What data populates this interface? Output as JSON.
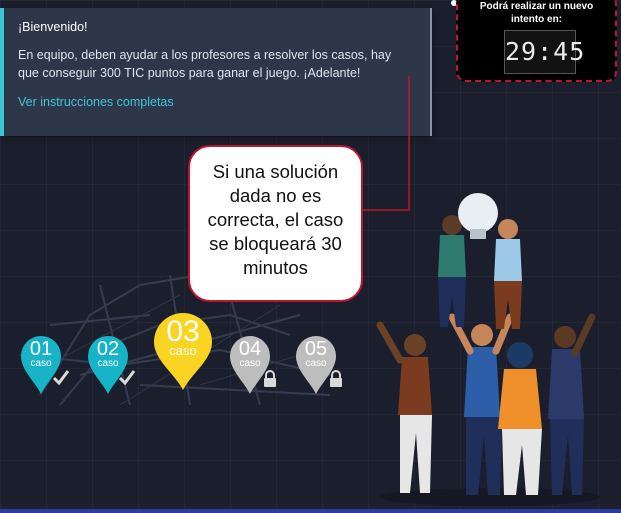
{
  "welcome": {
    "title": "¡Bienvenido!",
    "line1": "En equipo, deben ayudar a los profesores a resolver los casos, hay",
    "line2": "que conseguir 300 TIC puntos para ganar el juego. ¡Adelante!",
    "link": "Ver instrucciones completas"
  },
  "timer": {
    "label_line1": "Podrá realizar un nuevo",
    "label_line2": "intento en:",
    "value": "29:45"
  },
  "callout": {
    "lines": [
      "Si una solución",
      "dada no es",
      "correcta, el caso",
      "se bloqueará 30",
      "minutos"
    ]
  },
  "cases": [
    {
      "number": "01",
      "word": "caso",
      "state": "completed",
      "color": "#17b3c7"
    },
    {
      "number": "02",
      "word": "caso",
      "state": "completed",
      "color": "#17b3c7"
    },
    {
      "number": "03",
      "word": "caso",
      "state": "current",
      "color": "#f9d423"
    },
    {
      "number": "04",
      "word": "caso",
      "state": "locked",
      "color": "#bdbdbd"
    },
    {
      "number": "05",
      "word": "caso",
      "state": "locked",
      "color": "#bdbdbd"
    }
  ],
  "colors": {
    "background": "#1b1e2c",
    "panel": "#2e3649",
    "accent": "#3fc6d4",
    "alert": "#c0152a"
  },
  "icons": [
    "check-icon",
    "lock-icon",
    "map-pin-icon"
  ]
}
